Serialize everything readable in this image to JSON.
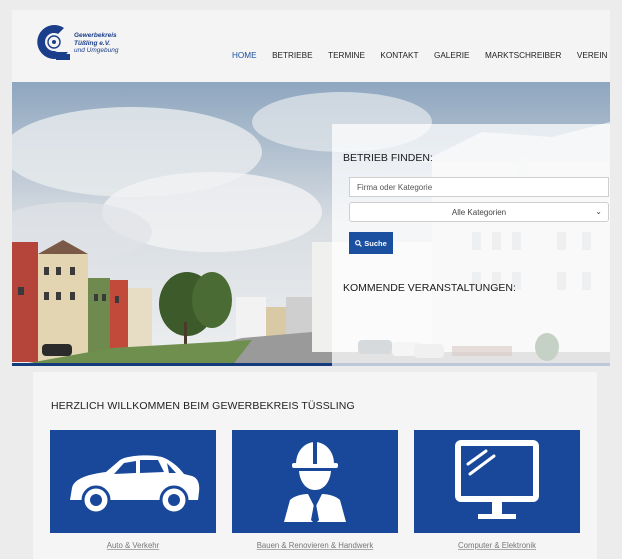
{
  "logo": {
    "line1": "Gewerbekreis",
    "line2": "Tüßling e.V.",
    "line3": "und Umgebung"
  },
  "nav": {
    "items": [
      "HOME",
      "BETRIEBE",
      "TERMINE",
      "KONTAKT",
      "GALERIE",
      "MARKTSCHREIBER",
      "VEREIN"
    ],
    "active": "HOME"
  },
  "search_panel": {
    "title": "BETRIEB FINDEN:",
    "input_placeholder": "Firma oder Kategorie",
    "select_value": "Alle Kategorien",
    "button_label": "Suche",
    "events_title": "KOMMENDE VERANSTALTUNGEN:"
  },
  "main": {
    "welcome": "HERZLICH WILLKOMMEN BEIM GEWERBEKREIS TÜSSLING",
    "categories": [
      {
        "label": "Auto & Verkehr",
        "icon": "car-icon"
      },
      {
        "label": "Bauen & Renovieren & Handwerk",
        "icon": "worker-icon"
      },
      {
        "label": "Computer & Elektronik",
        "icon": "monitor-icon"
      }
    ]
  },
  "colors": {
    "brand_blue": "#1b4fa0",
    "card_blue": "#19489a"
  }
}
